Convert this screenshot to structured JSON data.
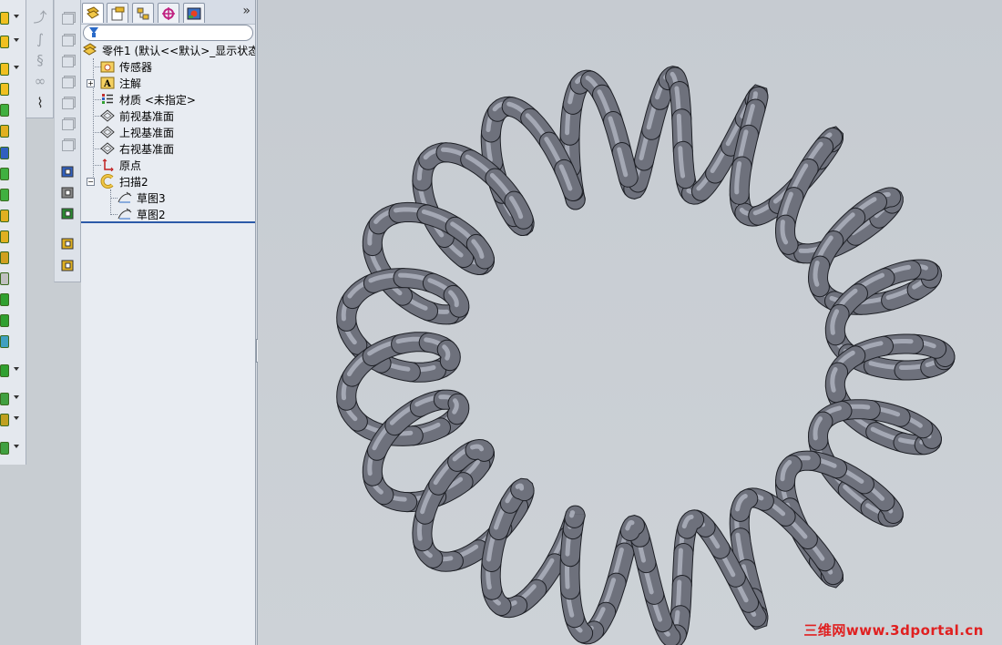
{
  "feature_tree": {
    "tabs": [
      "feature-manager-icon",
      "property-manager-icon",
      "configuration-manager-icon",
      "dimxpert-icon",
      "display-manager-icon"
    ],
    "more_label": "»",
    "root_label": "零件1 (默认<<默认>_显示状态",
    "items": [
      {
        "label": "传感器",
        "icon": "sensor-folder-icon"
      },
      {
        "label": "注解",
        "icon": "annotation-icon"
      },
      {
        "label": "材质 <未指定>",
        "icon": "material-icon"
      },
      {
        "label": "前视基准面",
        "icon": "plane-icon"
      },
      {
        "label": "上视基准面",
        "icon": "plane-icon"
      },
      {
        "label": "右视基准面",
        "icon": "plane-icon"
      },
      {
        "label": "原点",
        "icon": "origin-icon"
      },
      {
        "label": "扫描2",
        "icon": "sweep-icon"
      },
      {
        "label": "草图3",
        "icon": "sketch-icon"
      },
      {
        "label": "草图2",
        "icon": "sketch-icon"
      }
    ],
    "expanders": {
      "annotations": "+",
      "sweep": "−"
    }
  },
  "viewport": {
    "model": "helical-torus-spring",
    "tube_color": "#6e717c",
    "background": "#c8cdd2",
    "watermark": "三维网www.3dportal.cn"
  },
  "colors": {
    "accent": "#2c5aa8",
    "watermark": "#e02020"
  }
}
